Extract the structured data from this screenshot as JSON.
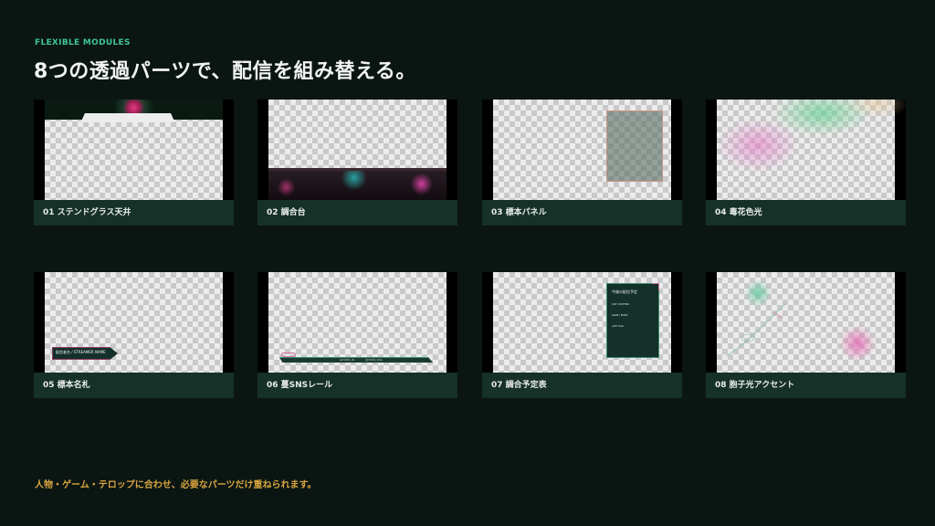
{
  "header": {
    "eyebrow": "FLEXIBLE MODULES",
    "title": "8つの透過パーツで、配信を組み替える。"
  },
  "modules": [
    {
      "label": "01 ステンドグラス天井"
    },
    {
      "label": "02 調合台"
    },
    {
      "label": "03 標本パネル"
    },
    {
      "label": "04 毒花色光"
    },
    {
      "label": "05 標本名札",
      "plate_text": "配信者名 / STREAMER NAME"
    },
    {
      "label": "06 蔓SNSレール",
      "rail_handles": [
        "@YOUR_ID",
        "@YOUR_TAG"
      ]
    },
    {
      "label": "07 調合予定表",
      "schedule_title": "今後の配信予定",
      "schedule_events": [
        "JUST CHATTING",
        "GAME / MUSIC",
        "LATE TALK"
      ]
    },
    {
      "label": "08 胞子光アクセント"
    }
  ],
  "footer": {
    "text": "人物・ゲーム・テロップに合わせ、必要なパーツだけ重ねられます。"
  },
  "colors": {
    "background": "#0b1613",
    "accent_green": "#3fc49a",
    "accent_gold": "#d9a53f",
    "label_bar": "#163127"
  }
}
